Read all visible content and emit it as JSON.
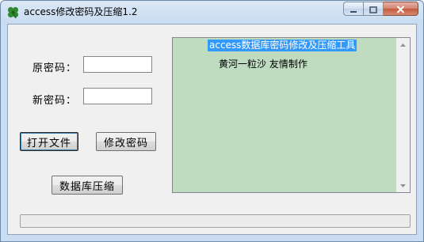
{
  "window": {
    "title": "access修改密码及压缩1.2",
    "icon": "four-leaf-clover-icon",
    "controls": {
      "minimize_icon": "minimize-icon",
      "maximize_icon": "maximize-icon",
      "close_icon": "close-icon"
    }
  },
  "form": {
    "old_password_label": "原密码：",
    "new_password_label": "新密码：",
    "old_password_value": "",
    "new_password_value": "",
    "open_file_button": "打开文件",
    "change_password_button": "修改密码",
    "compress_button": "数据库压缩"
  },
  "info_box": {
    "line1": "access数据库密码修改及压缩工具",
    "line2": "黄河一粒沙 友情制作"
  },
  "colors": {
    "info_box_bg": "#c0dcc0",
    "selection_bg": "#3399ff"
  }
}
